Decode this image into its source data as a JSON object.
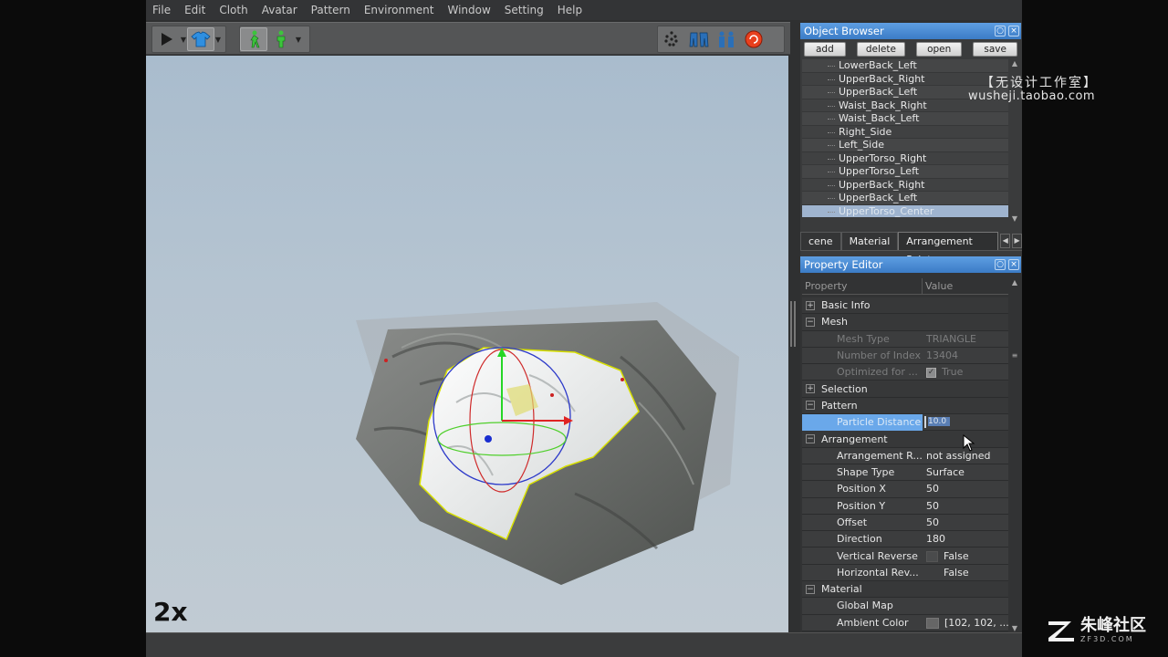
{
  "menu": [
    "File",
    "Edit",
    "Cloth",
    "Avatar",
    "Pattern",
    "Environment",
    "Window",
    "Setting",
    "Help"
  ],
  "viewport": {
    "speed": "2x"
  },
  "object_browser": {
    "title": "Object Browser",
    "buttons": {
      "add": "add",
      "delete": "delete",
      "open": "open",
      "save": "save"
    },
    "items": [
      "LowerBack_Left",
      "UpperBack_Right",
      "UpperBack_Left",
      "Waist_Back_Right",
      "Waist_Back_Left",
      "Right_Side",
      "Left_Side",
      "UpperTorso_Right",
      "UpperTorso_Left",
      "UpperBack_Right",
      "UpperBack_Left",
      "UpperTorso_Center"
    ],
    "selected_index": 11,
    "tabs": [
      "cene",
      "Material",
      "Arrangement Point"
    ],
    "active_tab": 2
  },
  "property_editor": {
    "title": "Property Editor",
    "col_property": "Property",
    "col_value": "Value",
    "sections": {
      "basic_info": "Basic Info",
      "mesh": "Mesh",
      "selection": "Selection",
      "pattern": "Pattern",
      "arrangement": "Arrangement",
      "material": "Material"
    },
    "mesh_type_k": "Mesh Type",
    "mesh_type_v": "TRIANGLE",
    "num_index_k": "Number of Index",
    "num_index_v": "13404",
    "optimized_k": "Optimized for ...",
    "optimized_v": "True",
    "particle_k": "Particle Distance",
    "particle_v": "10.0",
    "arr_ref_k": "Arrangement R...",
    "arr_ref_v": "not assigned",
    "shape_k": "Shape Type",
    "shape_v": "Surface",
    "posx_k": "Position X",
    "posx_v": "50",
    "posy_k": "Position Y",
    "posy_v": "50",
    "offset_k": "Offset",
    "offset_v": "50",
    "dir_k": "Direction",
    "dir_v": "180",
    "vrev_k": "Vertical Reverse",
    "vrev_v": "False",
    "hrev_k": "Horizontal Rev...",
    "hrev_v": "False",
    "global_map_k": "Global Map",
    "ambient_k": "Ambient Color",
    "ambient_v": "[102, 102, ..."
  },
  "watermarks": {
    "line1": "【无设计工作室】",
    "line2": "wusheji.taobao.com",
    "brand_cn": "朱峰社区",
    "brand_en": "ZF3D.COM"
  },
  "colors": {
    "panel_title": "#4a8ad4",
    "selection": "#6aa8ea",
    "viewport_sky": "#b5c4d1"
  }
}
